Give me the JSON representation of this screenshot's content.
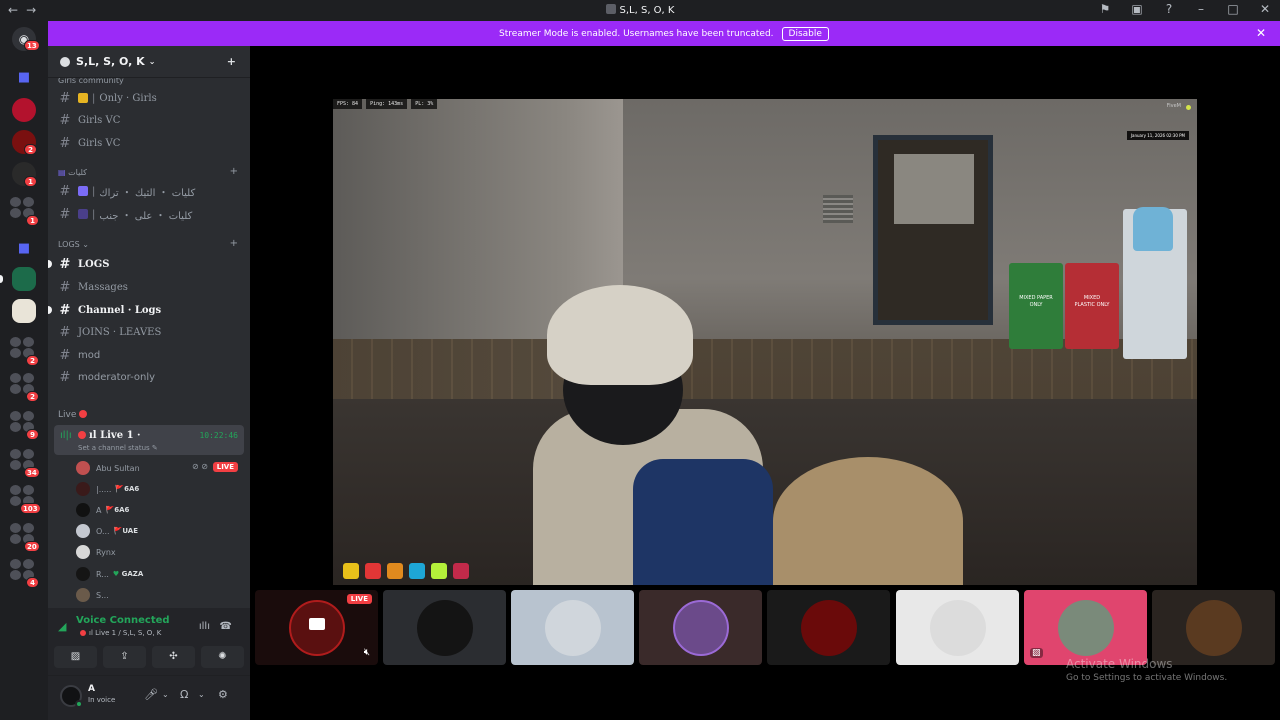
{
  "window": {
    "title": "S,L, S, O, K"
  },
  "rail": {
    "badges": [
      "13",
      "2",
      "1",
      "1",
      "2",
      "2",
      "9",
      "34",
      "103",
      "20",
      "4"
    ]
  },
  "banner": {
    "text": "Streamer Mode is enabled. Usernames have been truncated.",
    "button": "Disable"
  },
  "server": {
    "name": "S,L, S, O, K"
  },
  "categories": {
    "girls_community": "Girls community",
    "kuliyat": "كليات",
    "logs": "LOGS",
    "live": "Live"
  },
  "channels": [
    {
      "label": "Only · Girls"
    },
    {
      "label": "Girls VC"
    },
    {
      "label": "Girls VC"
    },
    {
      "label": "كليات ・ الثيك ・ تراك"
    },
    {
      "label": "كليات ・ على ・ جنب"
    },
    {
      "label": "LOGS"
    },
    {
      "label": "Massages"
    },
    {
      "label": "Channel · Logs"
    },
    {
      "label": "JOINS · LEAVES"
    },
    {
      "label": "mod"
    },
    {
      "label": "moderator-only"
    }
  ],
  "voice_channel": {
    "name": "ıl Live 1 ·",
    "time": "10:22:46",
    "status": "Set a channel status"
  },
  "members": [
    {
      "name": "Abu Sultan",
      "tag": "",
      "live": "LIVE"
    },
    {
      "name": "|.....",
      "tag": "6A6"
    },
    {
      "name": "A",
      "tag": "6A6"
    },
    {
      "name": "O...",
      "tag": "UAE"
    },
    {
      "name": "Rynx",
      "tag": ""
    },
    {
      "name": "R...",
      "tag": "GAZA"
    },
    {
      "name": "S...",
      "tag": ""
    }
  ],
  "voice_panel": {
    "title": "Voice Connected",
    "subtitle": "ıl Live 1 / S,L, S, O, K"
  },
  "user": {
    "name": "A",
    "status": "In voice"
  },
  "stream_hud": {
    "fps": "FPS: 84",
    "ping": "Ping: 143ms",
    "pl": "PL: 3%",
    "date": "January 11, 2026 02:30 PM",
    "bins": {
      "green": "MIXED PAPER ONLY",
      "red": "MIXED PLASTIC ONLY"
    }
  },
  "tiles": {
    "live_label": "LIVE"
  },
  "watermark": {
    "line1": "Activate Windows",
    "line2": "Go to Settings to activate Windows."
  },
  "colors": {
    "banner": "#9b2af7",
    "online": "#23a55a",
    "danger": "#f23f43",
    "sidebar": "#2b2d31",
    "rail": "#1e1f22"
  }
}
